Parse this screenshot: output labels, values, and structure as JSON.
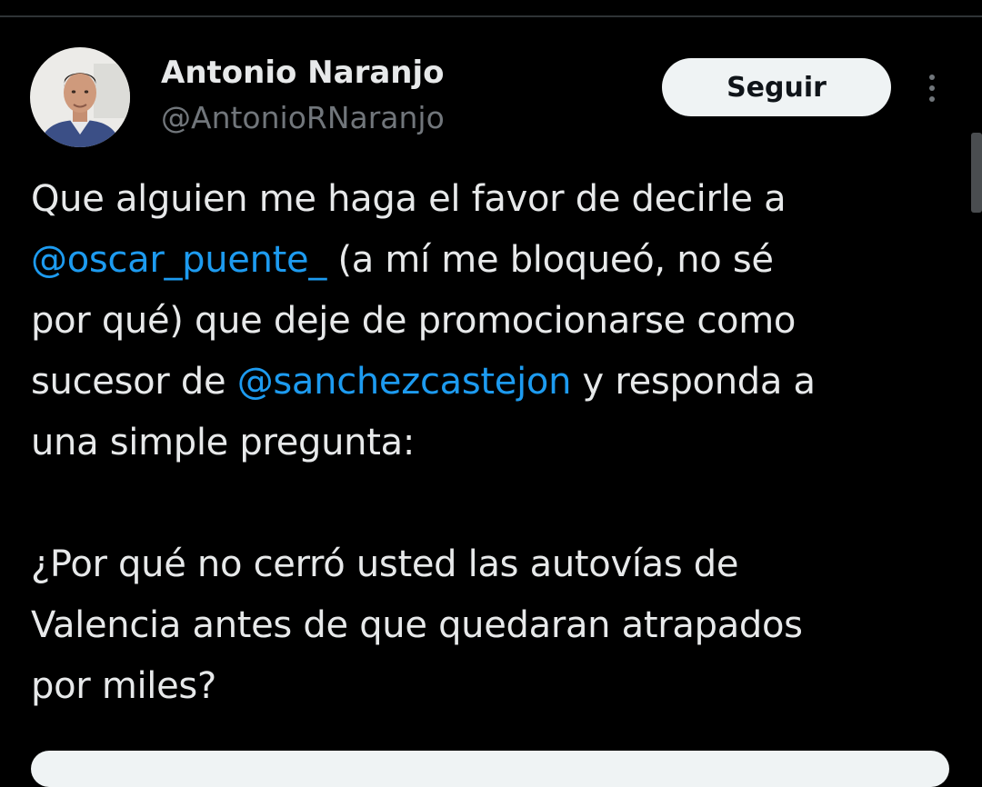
{
  "tweet": {
    "author": {
      "display_name": "Antonio Naranjo",
      "handle": "@AntonioRNaranjo"
    },
    "follow_label": "Seguir",
    "body": {
      "line1": "Que alguien me haga el favor de decirle a",
      "mention1": "@oscar_puente_",
      "line2_after": " (a mí me bloqueó, no sé",
      "line3": "por qué) que deje de promocionarse como",
      "line4_before": "sucesor de ",
      "mention2": "@sanchezcastejon",
      "line4_after": " y responda a",
      "line5": "una simple pregunta:",
      "line6": "¿Por qué no cerró usted las autovías de",
      "line7": "Valencia antes de que quedaran atrapados",
      "line8": "por miles?"
    }
  },
  "colors": {
    "background": "#000000",
    "text": "#e7e9ea",
    "secondary_text": "#71767b",
    "mention": "#1d9bf0",
    "button_bg": "#eff3f4",
    "button_text": "#0f1419"
  },
  "icons": {
    "more": "more-vertical-icon"
  }
}
